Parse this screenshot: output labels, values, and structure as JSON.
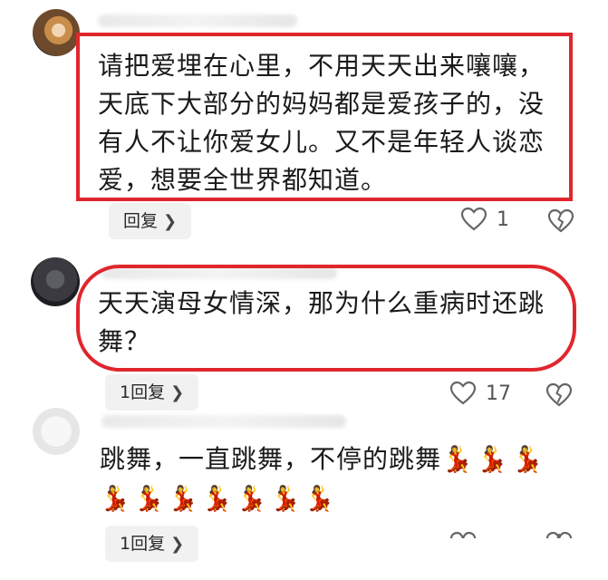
{
  "comments": [
    {
      "text_lines": [
        "请把爱埋在心里，不用天天出来嚷嚷，",
        "天底下大部分的妈妈都是爱孩子的，没",
        "有人不让你爱女儿。又不是年轻人谈恋",
        "爱，想要全世界都知道。"
      ],
      "reply_label": "回复",
      "like_count": "1",
      "highlight_color": "#e0262d"
    },
    {
      "text_lines": [
        "天天演母女情深，那为什么重病时还跳",
        "舞？"
      ],
      "reply_label": "1回复",
      "like_count": "17",
      "highlight_color": "#e0262d"
    },
    {
      "text_line1": "跳舞，一直跳舞，不停的跳舞",
      "emoji_inline": "💃💃💃",
      "emoji_line2": "💃💃💃💃💃💃💃",
      "reply_label": "1回复"
    }
  ],
  "icons": {
    "chevron": "chevron-right-icon",
    "like": "heart-outline-icon",
    "dislike": "broken-heart-icon"
  }
}
